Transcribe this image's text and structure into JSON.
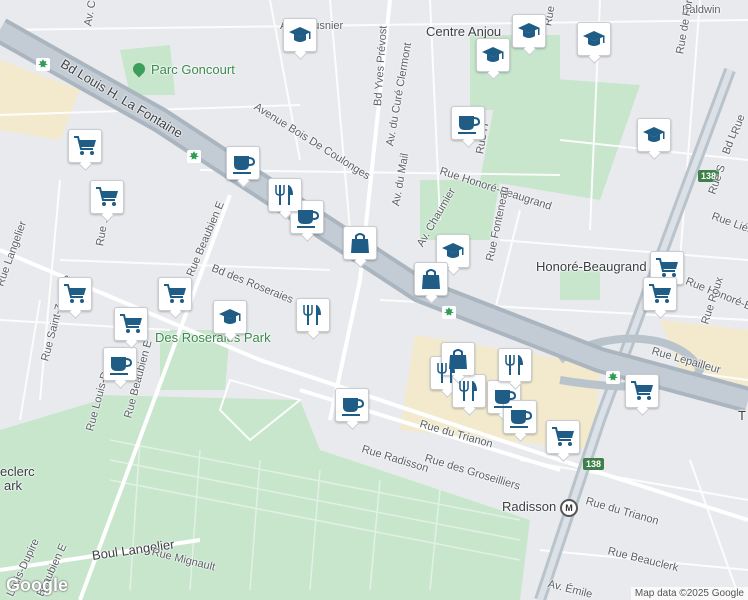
{
  "map": {
    "attribution": "Map data ©2025 Google",
    "logo_text": "Google",
    "colors": {
      "background": "#e9eaed",
      "road": "#ffffff",
      "highway": "#b9c3cc",
      "park": "#c7e6cc",
      "commercial": "#f3eacd",
      "poi_icon": "#1f5d86"
    }
  },
  "labels": {
    "bd_louis": "Bd Louis H. La Fontaine",
    "parc_goncourt": "Parc Goncourt",
    "av_meusnier": "Av. Meusnier",
    "bd_yves_prevost": "Bd Yves Prévost",
    "centre_anjou": "Centre Anjou",
    "rue_baldwin": "Baldwin",
    "rue_forbin": "Rue de Forbin-Janson",
    "av_bois_coulonges": "Avenue Bois De Coulonges",
    "av_cure_clermont": "Av. du Curé Clermont",
    "av_du_mail": "Av. du Mail",
    "rue_honore_beaugrand": "Rue Honoré-Beaugrand",
    "honore_beaugrand": "Honoré-Beaugrand",
    "rue_honore_beaugrand_east": "Rue Honoré-Beau",
    "rue_fonteneau": "Rue Fonteneau",
    "av_chaumier": "Av. Chaumier",
    "rue_beaubien_e": "Rue Beaubien E",
    "rue_beaubien_e2": "Rue Beaubien E",
    "bd_des_roseraies": "Bd des Roseraies",
    "des_roseraies_park": "Des Roseraies Park",
    "rue_saint_zotique": "Rue Saint-Zotique",
    "rue_louis_dupire": "Rue Louis-Dupire",
    "rue_du_trianon": "Rue du Trianon",
    "rue_du_trianon2": "Rue du Trianon",
    "rue_radisson": "Rue Radisson",
    "rue_des_groseilliers": "Rue des Groseilliers",
    "radisson": "Radisson",
    "boul_langelier": "Boul Langelier",
    "rue_mignault": "Rue Mignault",
    "rue_lepailleur": "Rue Lepailleur",
    "rue_roux": "Rue Roux",
    "rue_beauclerk": "Rue Beauclerk",
    "av_emile": "Av. Émile",
    "leclerc": "eclerc",
    "ark": "ark",
    "louis_dupire_sw": "Louis-Dupire",
    "beaubien_sw": "Beaubien E",
    "rue_langelier_w": "Rue Langelier",
    "rue_est": "Rue ... Est",
    "bd_138": "Bd L",
    "rue_s": "Rue S",
    "rue_lieb": "Rue Liéb",
    "rue_t": "T",
    "rue_r": "Rue",
    "rue_hb": "Rue H",
    "av_c": "Av. C",
    "rue_r2": "Rue"
  },
  "shields": {
    "r138a": "138",
    "r138b": "138"
  },
  "metro": {
    "symbol": "M"
  },
  "pois": [
    {
      "type": "school",
      "name": "school-icon"
    },
    {
      "type": "school",
      "name": "school-icon"
    },
    {
      "type": "school",
      "name": "school-icon"
    },
    {
      "type": "school",
      "name": "school-icon"
    },
    {
      "type": "school",
      "name": "school-icon"
    },
    {
      "type": "school",
      "name": "school-icon"
    },
    {
      "type": "school",
      "name": "school-icon"
    },
    {
      "type": "cafe",
      "name": "cafe-icon"
    },
    {
      "type": "cafe",
      "name": "cafe-icon"
    },
    {
      "type": "cafe",
      "name": "cafe-icon"
    },
    {
      "type": "cafe",
      "name": "cafe-icon"
    },
    {
      "type": "cafe",
      "name": "cafe-icon"
    },
    {
      "type": "cafe",
      "name": "cafe-icon"
    },
    {
      "type": "cafe",
      "name": "cafe-icon"
    },
    {
      "type": "shopping-cart",
      "name": "shopping-cart-icon"
    },
    {
      "type": "shopping-cart",
      "name": "shopping-cart-icon"
    },
    {
      "type": "shopping-cart",
      "name": "shopping-cart-icon"
    },
    {
      "type": "shopping-cart",
      "name": "shopping-cart-icon"
    },
    {
      "type": "shopping-cart",
      "name": "shopping-cart-icon"
    },
    {
      "type": "shopping-cart",
      "name": "shopping-cart-icon"
    },
    {
      "type": "shopping-cart",
      "name": "shopping-cart-icon"
    },
    {
      "type": "shopping-cart",
      "name": "shopping-cart-icon"
    },
    {
      "type": "shopping-cart",
      "name": "shopping-cart-icon"
    },
    {
      "type": "restaurant",
      "name": "restaurant-icon"
    },
    {
      "type": "restaurant",
      "name": "restaurant-icon"
    },
    {
      "type": "restaurant",
      "name": "restaurant-icon"
    },
    {
      "type": "restaurant",
      "name": "restaurant-icon"
    },
    {
      "type": "restaurant",
      "name": "restaurant-icon"
    },
    {
      "type": "shopping-bag",
      "name": "shopping-bag-icon"
    },
    {
      "type": "shopping-bag",
      "name": "shopping-bag-icon"
    },
    {
      "type": "shopping-bag",
      "name": "shopping-bag-icon"
    }
  ]
}
